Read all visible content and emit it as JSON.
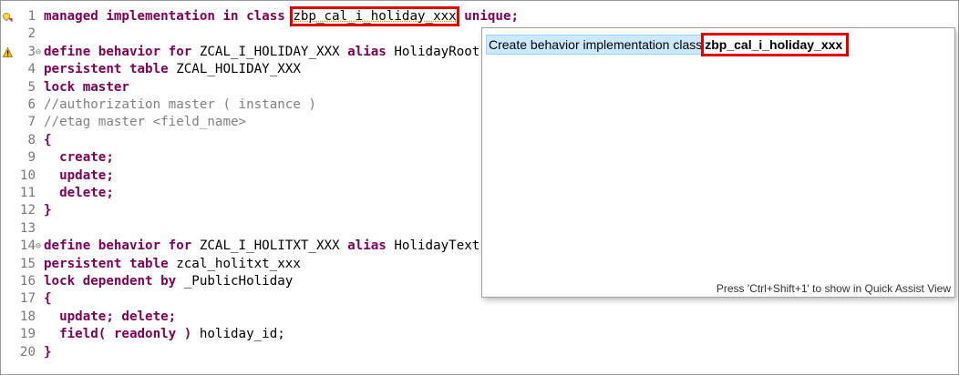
{
  "editor": {
    "lines": [
      {
        "n": "1",
        "segments": [
          {
            "t": "managed implementation in class ",
            "c": "kw"
          },
          {
            "t": "zbp_cal_i_holiday_xxx",
            "c": "id",
            "hl": true
          },
          {
            "t": " ",
            "c": "id"
          },
          {
            "t": "unique;",
            "c": "kw"
          }
        ]
      },
      {
        "n": "2",
        "segments": []
      },
      {
        "n": "3",
        "fold": "⊖",
        "segments": [
          {
            "t": "define behavior for ",
            "c": "kw"
          },
          {
            "t": "ZCAL_I_HOLIDAY_XXX ",
            "c": "id"
          },
          {
            "t": "alias ",
            "c": "kw"
          },
          {
            "t": "HolidayRoot",
            "c": "id"
          }
        ]
      },
      {
        "n": "4",
        "segments": [
          {
            "t": "persistent table ",
            "c": "kw"
          },
          {
            "t": "ZCAL_HOLIDAY_XXX",
            "c": "id"
          }
        ]
      },
      {
        "n": "5",
        "segments": [
          {
            "t": "lock master",
            "c": "kw"
          }
        ]
      },
      {
        "n": "6",
        "segments": [
          {
            "t": "//authorization master ( instance )",
            "c": "cm"
          }
        ]
      },
      {
        "n": "7",
        "segments": [
          {
            "t": "//etag master <field_name>",
            "c": "cm"
          }
        ]
      },
      {
        "n": "8",
        "segments": [
          {
            "t": "{",
            "c": "kw"
          }
        ]
      },
      {
        "n": "9",
        "segments": [
          {
            "t": "  create;",
            "c": "kw"
          }
        ]
      },
      {
        "n": "10",
        "segments": [
          {
            "t": "  update;",
            "c": "kw"
          }
        ]
      },
      {
        "n": "11",
        "segments": [
          {
            "t": "  delete;",
            "c": "kw"
          }
        ]
      },
      {
        "n": "12",
        "segments": [
          {
            "t": "}",
            "c": "kw"
          }
        ]
      },
      {
        "n": "13",
        "segments": []
      },
      {
        "n": "14",
        "fold": "⊖",
        "segments": [
          {
            "t": "define behavior for ",
            "c": "kw"
          },
          {
            "t": "ZCAL_I_HOLITXT_XXX ",
            "c": "id"
          },
          {
            "t": "alias ",
            "c": "kw"
          },
          {
            "t": "HolidayText",
            "c": "id"
          }
        ]
      },
      {
        "n": "15",
        "segments": [
          {
            "t": "persistent table ",
            "c": "kw"
          },
          {
            "t": "zcal_holitxt_xxx",
            "c": "id"
          }
        ]
      },
      {
        "n": "16",
        "segments": [
          {
            "t": "lock dependent by ",
            "c": "kw"
          },
          {
            "t": "_PublicHoliday",
            "c": "id"
          }
        ]
      },
      {
        "n": "17",
        "segments": [
          {
            "t": "{",
            "c": "kw"
          }
        ]
      },
      {
        "n": "18",
        "segments": [
          {
            "t": "  update; delete;",
            "c": "kw"
          }
        ]
      },
      {
        "n": "19",
        "segments": [
          {
            "t": "  field( readonly ) ",
            "c": "kw"
          },
          {
            "t": "holiday_id;",
            "c": "id"
          }
        ]
      },
      {
        "n": "20",
        "segments": [
          {
            "t": "}",
            "c": "kw"
          }
        ]
      }
    ],
    "markers": [
      {
        "line": "1",
        "icon": "quick-fix-lightbulb-icon"
      },
      {
        "line": "3",
        "icon": "warning-icon"
      }
    ]
  },
  "popup": {
    "item_prefix": "Create behavior implementation class ",
    "item_class": "zbp_cal_i_holiday_xxx",
    "footer": "Press 'Ctrl+Shift+1' to show in Quick Assist View"
  },
  "colors": {
    "keyword": "#7f0055",
    "comment": "#808080",
    "highlight_box": "#e00000",
    "selection": "#cce8ff"
  }
}
